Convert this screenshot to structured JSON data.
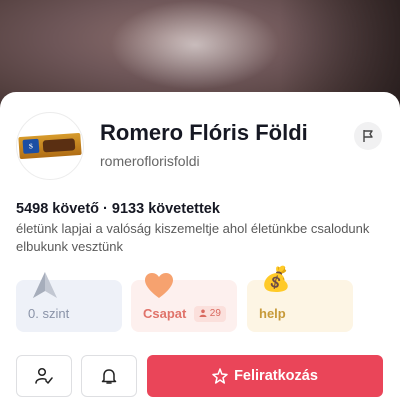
{
  "profile": {
    "name": "Romero Flóris Földi",
    "handle": "romerofloris­foldi",
    "stats": "5498 követő · 9133 követettek",
    "bio": "életünk lapjai a valóság kiszemeltje ahol életünkbe csalodunk elbukunk vesztünk"
  },
  "cards": {
    "level": {
      "label": "0. szint",
      "icon": "navigation-arrow-icon"
    },
    "team": {
      "label": "Csapat",
      "count": "29",
      "icon": "heart-icon"
    },
    "help": {
      "label": "help",
      "icon": "money-bag-icon",
      "emoji": "💰"
    }
  },
  "actions": {
    "subscribe_label": "Feliratkozás"
  },
  "colors": {
    "accent": "#ea4559",
    "team": "#e0736a",
    "help": "#c79a3a"
  }
}
